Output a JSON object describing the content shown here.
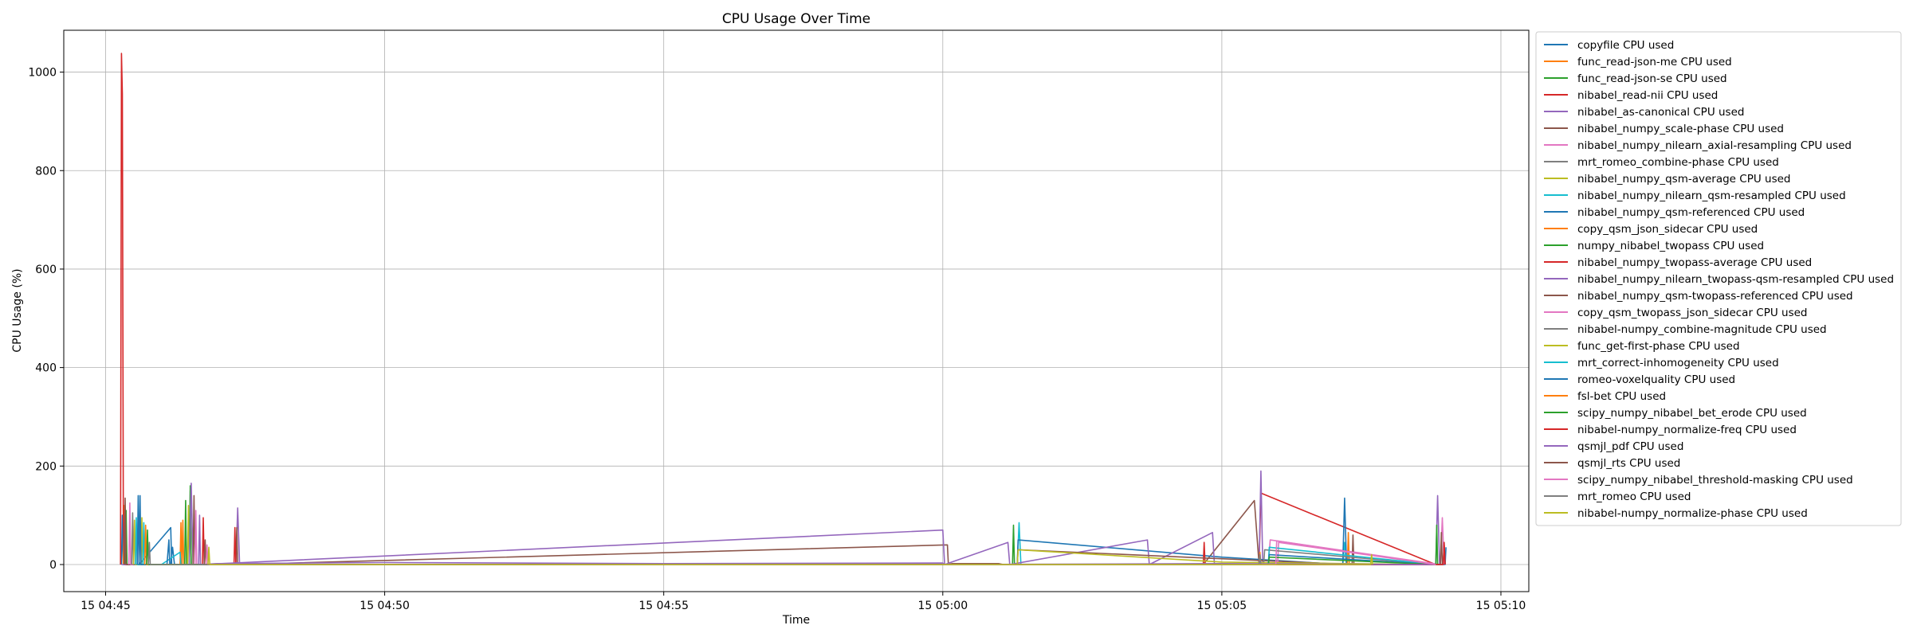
{
  "chart_data": {
    "type": "line",
    "title": "CPU Usage Over Time",
    "xlabel": "Time",
    "ylabel": "CPU Usage (%)",
    "xlim": [
      "15 04:44:15",
      "15 05:10:30"
    ],
    "ylim": [
      -55,
      1085
    ],
    "grid": true,
    "legend_position": "outside-right-top",
    "x_ticks": [
      {
        "t": "15 04:45:00",
        "label": "15 04:45"
      },
      {
        "t": "15 04:50:00",
        "label": "15 04:50"
      },
      {
        "t": "15 04:55:00",
        "label": "15 04:55"
      },
      {
        "t": "15 05:00:00",
        "label": "15 05:00"
      },
      {
        "t": "15 05:05:00",
        "label": "15 05:05"
      },
      {
        "t": "15 05:10:00",
        "label": "15 05:10"
      }
    ],
    "y_ticks": [
      0,
      200,
      400,
      600,
      800,
      1000
    ],
    "series": [
      {
        "name": "copyfile CPU used",
        "color": "#1f77b4",
        "points": [
          [
            "15 04:45:17",
            0
          ],
          [
            "15 04:45:18",
            100
          ],
          [
            "15 04:45:19",
            0
          ],
          [
            "15 04:46:10",
            0
          ],
          [
            "15 04:46:12",
            35
          ],
          [
            "15 04:46:14",
            0
          ]
        ]
      },
      {
        "name": "func_read-json-me CPU used",
        "color": "#ff7f0e",
        "points": [
          [
            "15 04:45:19",
            0
          ],
          [
            "15 04:45:20",
            120
          ],
          [
            "15 04:45:21",
            0
          ],
          [
            "15 04:46:22",
            0
          ],
          [
            "15 04:46:23",
            90
          ],
          [
            "15 04:46:24",
            0
          ]
        ]
      },
      {
        "name": "func_read-json-se CPU used",
        "color": "#2ca02c",
        "points": [
          [
            "15 04:45:21",
            0
          ],
          [
            "15 04:45:22",
            110
          ],
          [
            "15 04:45:23",
            0
          ],
          [
            "15 04:46:25",
            0
          ],
          [
            "15 04:46:26",
            130
          ],
          [
            "15 04:46:27",
            0
          ]
        ]
      },
      {
        "name": "nibabel_read-nii CPU used",
        "color": "#d62728",
        "points": [
          [
            "15 04:45:16",
            0
          ],
          [
            "15 04:45:17",
            1038
          ],
          [
            "15 04:45:18",
            956
          ],
          [
            "15 04:45:19",
            110
          ],
          [
            "15 04:45:20",
            0
          ],
          [
            "15 05:05:40",
            0
          ],
          [
            "15 05:05:42",
            145
          ],
          [
            "15 05:08:50",
            0
          ]
        ]
      },
      {
        "name": "nibabel_as-canonical CPU used",
        "color": "#9467bd",
        "points": [
          [
            "15 04:45:17",
            0
          ],
          [
            "15 04:45:40",
            0
          ],
          [
            "15 04:46:30",
            0
          ],
          [
            "15 04:47:20",
            0
          ],
          [
            "15 04:47:22",
            115
          ],
          [
            "15 04:47:24",
            0
          ],
          [
            "15 05:00:00",
            0
          ],
          [
            "15 05:03:00",
            0
          ],
          [
            "15 05:05:40",
            0
          ],
          [
            "15 05:05:42",
            190
          ],
          [
            "15 05:05:44",
            0
          ],
          [
            "15 05:08:50",
            0
          ],
          [
            "15 05:08:52",
            140
          ],
          [
            "15 05:08:54",
            0
          ]
        ]
      },
      {
        "name": "nibabel_numpy_scale-phase CPU used",
        "color": "#8c564b",
        "points": [
          [
            "15 04:45:20",
            0
          ],
          [
            "15 04:45:21",
            135
          ],
          [
            "15 04:45:22",
            0
          ],
          [
            "15 04:47:20",
            0
          ],
          [
            "15 04:47:21",
            75
          ],
          [
            "15 04:47:22",
            0
          ],
          [
            "15 05:00:05",
            40
          ],
          [
            "15 05:00:06",
            0
          ],
          [
            "15 05:04:40",
            0
          ],
          [
            "15 05:05:35",
            130
          ],
          [
            "15 05:05:40",
            0
          ]
        ]
      },
      {
        "name": "nibabel_numpy_nilearn_axial-resampling CPU used",
        "color": "#e377c2",
        "points": [
          [
            "15 04:45:25",
            0
          ],
          [
            "15 04:45:26",
            125
          ],
          [
            "15 04:45:27",
            0
          ],
          [
            "15 05:05:50",
            0
          ],
          [
            "15 05:05:52",
            50
          ],
          [
            "15 05:08:55",
            0
          ],
          [
            "15 05:08:57",
            95
          ],
          [
            "15 05:08:59",
            0
          ]
        ]
      },
      {
        "name": "mrt_romeo_combine-phase CPU used",
        "color": "#7f7f7f",
        "points": [
          [
            "15 04:45:28",
            0
          ],
          [
            "15 04:45:29",
            105
          ],
          [
            "15 04:45:30",
            0
          ],
          [
            "15 04:46:30",
            0
          ],
          [
            "15 04:46:31",
            150
          ],
          [
            "15 04:46:32",
            0
          ]
        ]
      },
      {
        "name": "nibabel_numpy_qsm-average CPU used",
        "color": "#bcbd22",
        "points": [
          [
            "15 04:45:30",
            0
          ],
          [
            "15 04:45:31",
            90
          ],
          [
            "15 04:45:32",
            0
          ],
          [
            "15 04:46:28",
            0
          ],
          [
            "15 04:46:29",
            120
          ],
          [
            "15 04:46:30",
            0
          ]
        ]
      },
      {
        "name": "nibabel_numpy_nilearn_qsm-resampled CPU used",
        "color": "#17becf",
        "points": [
          [
            "15 04:45:32",
            0
          ],
          [
            "15 04:45:33",
            95
          ],
          [
            "15 04:45:34",
            0
          ],
          [
            "15 05:01:20",
            0
          ],
          [
            "15 05:01:22",
            85
          ],
          [
            "15 05:01:24",
            0
          ],
          [
            "15 05:07:10",
            0
          ],
          [
            "15 05:07:12",
            45
          ],
          [
            "15 05:07:14",
            0
          ]
        ]
      },
      {
        "name": "nibabel_numpy_qsm-referenced CPU used",
        "color": "#1f77b4",
        "points": [
          [
            "15 04:45:34",
            0
          ],
          [
            "15 04:45:35",
            140
          ],
          [
            "15 04:45:36",
            0
          ],
          [
            "15 04:46:10",
            75
          ],
          [
            "15 04:46:11",
            0
          ],
          [
            "15 05:01:20",
            0
          ],
          [
            "15 05:01:21",
            50
          ],
          [
            "15 05:05:00",
            15
          ],
          [
            "15 05:07:10",
            0
          ],
          [
            "15 05:07:12",
            135
          ],
          [
            "15 05:07:14",
            0
          ],
          [
            "15 05:09:00",
            0
          ],
          [
            "15 05:09:01",
            35
          ]
        ]
      },
      {
        "name": "copy_qsm_json_sidecar CPU used",
        "color": "#ff7f0e",
        "points": [
          [
            "15 04:46:20",
            0
          ],
          [
            "15 04:46:21",
            85
          ],
          [
            "15 04:46:22",
            0
          ],
          [
            "15 05:07:15",
            0
          ],
          [
            "15 05:07:16",
            65
          ],
          [
            "15 05:07:17",
            0
          ]
        ]
      },
      {
        "name": "numpy_nibabel_twopass CPU used",
        "color": "#2ca02c",
        "points": [
          [
            "15 04:46:30",
            0
          ],
          [
            "15 04:46:31",
            160
          ],
          [
            "15 04:46:32",
            0
          ],
          [
            "15 05:01:15",
            0
          ],
          [
            "15 05:01:16",
            80
          ],
          [
            "15 05:01:17",
            0
          ],
          [
            "15 05:08:50",
            0
          ],
          [
            "15 05:08:51",
            80
          ],
          [
            "15 05:08:52",
            0
          ]
        ]
      },
      {
        "name": "nibabel_numpy_twopass-average CPU used",
        "color": "#d62728",
        "points": [
          [
            "15 04:47:18",
            0
          ],
          [
            "15 04:47:19",
            75
          ],
          [
            "15 04:47:20",
            0
          ],
          [
            "15 05:04:40",
            0
          ],
          [
            "15 05:04:41",
            45
          ],
          [
            "15 05:04:42",
            0
          ],
          [
            "15 05:08:58",
            0
          ],
          [
            "15 05:08:59",
            45
          ],
          [
            "15 05:09:00",
            0
          ]
        ]
      },
      {
        "name": "nibabel_numpy_nilearn_twopass-qsm-resampled CPU used",
        "color": "#9467bd",
        "points": [
          [
            "15 04:46:30",
            0
          ],
          [
            "15 04:46:32",
            165
          ],
          [
            "15 04:46:34",
            0
          ],
          [
            "15 04:46:40",
            0
          ],
          [
            "15 04:46:41",
            100
          ],
          [
            "15 04:46:42",
            0
          ],
          [
            "15 05:00:00",
            70
          ],
          [
            "15 05:00:02",
            0
          ],
          [
            "15 05:01:10",
            45
          ],
          [
            "15 05:01:12",
            0
          ],
          [
            "15 05:03:40",
            50
          ],
          [
            "15 05:03:42",
            0
          ],
          [
            "15 05:04:50",
            65
          ],
          [
            "15 05:04:52",
            0
          ],
          [
            "15 05:06:00",
            0
          ],
          [
            "15 05:08:50",
            0
          ]
        ]
      },
      {
        "name": "nibabel_numpy_qsm-twopass-referenced CPU used",
        "color": "#8c564b",
        "points": [
          [
            "15 04:46:34",
            0
          ],
          [
            "15 04:46:35",
            140
          ],
          [
            "15 04:46:36",
            0
          ],
          [
            "15 05:01:20",
            0
          ],
          [
            "15 05:01:21",
            30
          ],
          [
            "15 05:07:20",
            0
          ],
          [
            "15 05:07:21",
            60
          ],
          [
            "15 05:07:22",
            0
          ],
          [
            "15 05:08:55",
            0
          ],
          [
            "15 05:08:56",
            65
          ],
          [
            "15 05:08:57",
            0
          ]
        ]
      },
      {
        "name": "copy_qsm_twopass_json_sidecar CPU used",
        "color": "#e377c2",
        "points": [
          [
            "15 04:46:36",
            0
          ],
          [
            "15 04:46:37",
            110
          ],
          [
            "15 04:46:38",
            0
          ],
          [
            "15 05:06:00",
            0
          ],
          [
            "15 05:06:01",
            45
          ],
          [
            "15 05:08:50",
            0
          ]
        ]
      },
      {
        "name": "nibabel-numpy_combine-magnitude CPU used",
        "color": "#7f7f7f",
        "points": [
          [
            "15 04:45:36",
            0
          ],
          [
            "15 04:45:37",
            100
          ],
          [
            "15 04:45:38",
            0
          ],
          [
            "15 05:05:45",
            0
          ],
          [
            "15 05:05:46",
            30
          ],
          [
            "15 05:08:50",
            0
          ]
        ]
      },
      {
        "name": "func_get-first-phase CPU used",
        "color": "#bcbd22",
        "points": [
          [
            "15 04:45:38",
            0
          ],
          [
            "15 04:45:39",
            95
          ],
          [
            "15 04:45:40",
            0
          ],
          [
            "15 05:01:20",
            0
          ],
          [
            "15 05:01:21",
            30
          ],
          [
            "15 05:05:00",
            5
          ],
          [
            "15 05:08:50",
            0
          ]
        ]
      },
      {
        "name": "mrt_correct-inhomogeneity CPU used",
        "color": "#17becf",
        "points": [
          [
            "15 04:45:40",
            0
          ],
          [
            "15 04:45:41",
            85
          ],
          [
            "15 04:45:42",
            0
          ],
          [
            "15 04:46:00",
            0
          ],
          [
            "15 04:46:20",
            25
          ],
          [
            "15 04:46:21",
            0
          ],
          [
            "15 05:05:50",
            0
          ],
          [
            "15 05:05:51",
            35
          ],
          [
            "15 05:08:50",
            0
          ]
        ]
      },
      {
        "name": "romeo-voxelquality CPU used",
        "color": "#1f77b4",
        "points": [
          [
            "15 04:45:36",
            0
          ],
          [
            "15 04:45:37",
            140
          ],
          [
            "15 04:45:38",
            0
          ],
          [
            "15 04:46:06",
            0
          ],
          [
            "15 04:46:08",
            50
          ],
          [
            "15 04:46:09",
            0
          ],
          [
            "15 05:05:50",
            0
          ],
          [
            "15 05:05:51",
            20
          ],
          [
            "15 05:08:50",
            0
          ]
        ]
      },
      {
        "name": "fsl-bet CPU used",
        "color": "#ff7f0e",
        "points": [
          [
            "15 04:45:42",
            0
          ],
          [
            "15 04:45:43",
            80
          ],
          [
            "15 04:45:44",
            0
          ],
          [
            "15 05:05:40",
            0
          ],
          [
            "15 05:05:41",
            25
          ],
          [
            "15 05:05:42",
            0
          ]
        ]
      },
      {
        "name": "scipy_numpy_nibabel_bet_erode CPU used",
        "color": "#2ca02c",
        "points": [
          [
            "15 04:45:44",
            0
          ],
          [
            "15 04:45:45",
            70
          ],
          [
            "15 04:45:46",
            0
          ],
          [
            "15 05:05:50",
            0
          ],
          [
            "15 05:05:51",
            15
          ],
          [
            "15 05:08:50",
            0
          ]
        ]
      },
      {
        "name": "nibabel-numpy_normalize-freq CPU used",
        "color": "#d62728",
        "points": [
          [
            "15 04:46:44",
            0
          ],
          [
            "15 04:46:45",
            95
          ],
          [
            "15 04:46:46",
            0
          ],
          [
            "15 05:08:58",
            0
          ],
          [
            "15 05:08:59",
            40
          ],
          [
            "15 05:09:00",
            0
          ]
        ]
      },
      {
        "name": "qsmjl_pdf CPU used",
        "color": "#9467bd",
        "points": [
          [
            "15 04:46:40",
            0
          ],
          [
            "15 04:47:00",
            2
          ],
          [
            "15 04:50:00",
            4
          ],
          [
            "15 04:55:00",
            2
          ],
          [
            "15 05:00:00",
            3
          ],
          [
            "15 05:00:02",
            0
          ],
          [
            "15 05:05:00",
            2
          ],
          [
            "15 05:08:50",
            0
          ]
        ]
      },
      {
        "name": "qsmjl_rts CPU used",
        "color": "#8c564b",
        "points": [
          [
            "15 04:46:46",
            0
          ],
          [
            "15 04:46:47",
            50
          ],
          [
            "15 04:46:48",
            0
          ],
          [
            "15 05:00:05",
            0
          ],
          [
            "15 05:00:10",
            2
          ],
          [
            "15 05:01:00",
            2
          ],
          [
            "15 05:01:05",
            0
          ]
        ]
      },
      {
        "name": "scipy_numpy_nibabel_threshold-masking CPU used",
        "color": "#e377c2",
        "points": [
          [
            "15 04:46:48",
            0
          ],
          [
            "15 04:46:49",
            40
          ],
          [
            "15 04:46:50",
            0
          ],
          [
            "15 05:05:58",
            0
          ],
          [
            "15 05:05:59",
            48
          ],
          [
            "15 05:08:50",
            0
          ]
        ]
      },
      {
        "name": "mrt_romeo CPU used",
        "color": "#7f7f7f",
        "points": [
          [
            "15 04:45:46",
            0
          ],
          [
            "15 04:45:47",
            45
          ],
          [
            "15 04:45:48",
            0
          ],
          [
            "15 05:05:40",
            0
          ],
          [
            "15 05:05:41",
            20
          ],
          [
            "15 05:05:42",
            0
          ]
        ]
      },
      {
        "name": "nibabel-numpy_normalize-phase CPU used",
        "color": "#bcbd22",
        "points": [
          [
            "15 04:46:50",
            0
          ],
          [
            "15 04:46:51",
            35
          ],
          [
            "15 04:46:52",
            0
          ],
          [
            "15 05:07:40",
            0
          ],
          [
            "15 05:07:41",
            20
          ],
          [
            "15 05:07:42",
            0
          ]
        ]
      }
    ]
  }
}
